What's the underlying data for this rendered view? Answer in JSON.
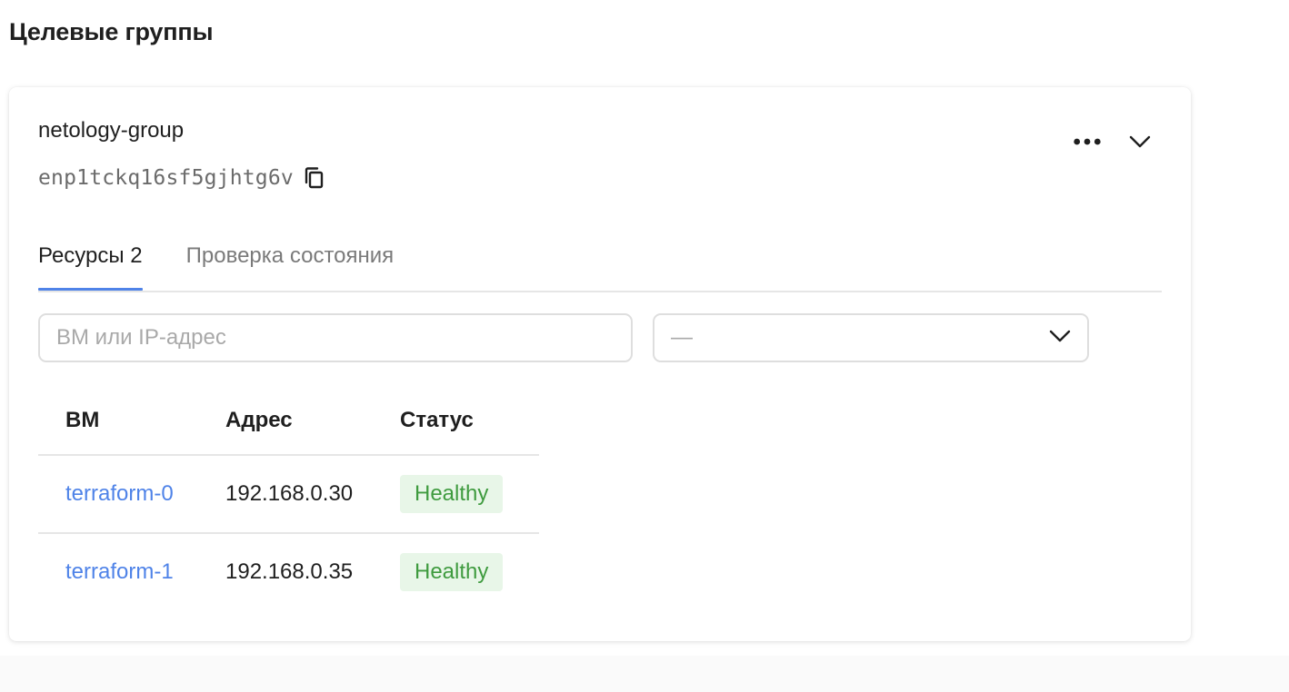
{
  "page": {
    "title": "Целевые группы"
  },
  "group": {
    "name": "netology-group",
    "id": "enp1tckq16sf5gjhtg6v"
  },
  "tabs": [
    {
      "label": "Ресурсы 2",
      "active": true
    },
    {
      "label": "Проверка состояния",
      "active": false
    }
  ],
  "filters": {
    "search_placeholder": "ВМ или IP-адрес",
    "select_value": "—"
  },
  "table": {
    "columns": [
      "ВМ",
      "Адрес",
      "Статус"
    ],
    "rows": [
      {
        "vm": "terraform-0",
        "address": "192.168.0.30",
        "status": "Healthy"
      },
      {
        "vm": "terraform-1",
        "address": "192.168.0.35",
        "status": "Healthy"
      }
    ]
  },
  "colors": {
    "accent": "#4f83e8",
    "healthy_text": "#3f9b3f",
    "healthy_bg": "#e8f6e8",
    "muted_text": "#6b6b6b"
  },
  "icons": {
    "copy": "copy-icon",
    "more": "more-horizontal-icon",
    "collapse": "chevron-down-icon",
    "select": "chevron-down-icon"
  }
}
